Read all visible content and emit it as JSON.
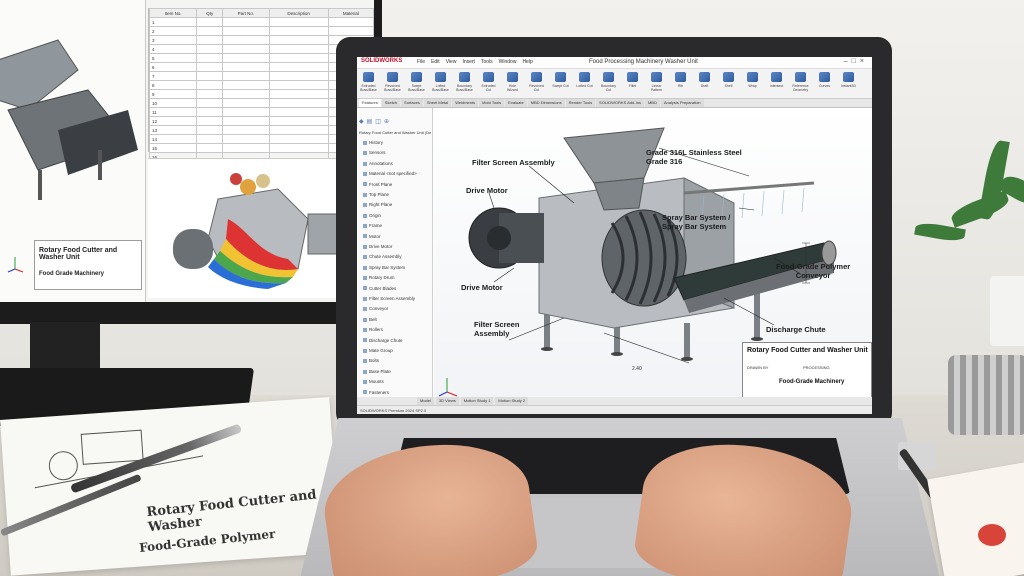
{
  "ext_monitor": {
    "table_headers": [
      "Item No.",
      "Qty",
      "Part No.",
      "Description",
      "Material"
    ],
    "part_numbers": [
      "1",
      "2",
      "3",
      "4",
      "5",
      "6",
      "7",
      "8",
      "9",
      "10",
      "11",
      "12",
      "13",
      "14",
      "15",
      "16"
    ],
    "title_block_name": "Rotary Food Cutter and Washer Unit",
    "title_block_company": "Food Grade Machinery"
  },
  "paper": {
    "line1": "Rotary Food Cutter and Washer",
    "line2": "Food-Grade Polymer"
  },
  "app": {
    "logo_text": "SOLIDWORKS",
    "document_title": "Food Processing Machinery Washer Unit",
    "menus": [
      "File",
      "Edit",
      "View",
      "Insert",
      "Tools",
      "Window",
      "Help"
    ],
    "toolbar": [
      {
        "icon": "extruded-boss-icon",
        "label": "Extruded Boss/Base"
      },
      {
        "icon": "revolved-boss-icon",
        "label": "Revolved Boss/Base"
      },
      {
        "icon": "swept-boss-icon",
        "label": "Swept Boss/Base"
      },
      {
        "icon": "lofted-boss-icon",
        "label": "Lofted Boss/Base"
      },
      {
        "icon": "boundary-boss-icon",
        "label": "Boundary Boss/Base"
      },
      {
        "icon": "extruded-cut-icon",
        "label": "Extruded Cut"
      },
      {
        "icon": "hole-wizard-icon",
        "label": "Hole Wizard"
      },
      {
        "icon": "revolved-cut-icon",
        "label": "Revolved Cut"
      },
      {
        "icon": "swept-cut-icon",
        "label": "Swept Cut"
      },
      {
        "icon": "lofted-cut-icon",
        "label": "Lofted Cut"
      },
      {
        "icon": "boundary-cut-icon",
        "label": "Boundary Cut"
      },
      {
        "icon": "fillet-icon",
        "label": "Fillet"
      },
      {
        "icon": "linear-pattern-icon",
        "label": "Linear Pattern"
      },
      {
        "icon": "rib-icon",
        "label": "Rib"
      },
      {
        "icon": "draft-icon",
        "label": "Draft"
      },
      {
        "icon": "shell-icon",
        "label": "Shell"
      },
      {
        "icon": "wrap-icon",
        "label": "Wrap"
      },
      {
        "icon": "intersect-icon",
        "label": "Intersect"
      },
      {
        "icon": "reference-geometry-icon",
        "label": "Reference Geometry"
      },
      {
        "icon": "curves-icon",
        "label": "Curves"
      },
      {
        "icon": "instant3d-icon",
        "label": "Instant3D"
      }
    ],
    "command_tabs": [
      "Features",
      "Sketch",
      "Surfaces",
      "Sheet Metal",
      "Weldments",
      "Mold Tools",
      "Evaluate",
      "MBD Dimensions",
      "Render Tools",
      "SOLIDWORKS Add-Ins",
      "MBD",
      "Analysis Preparation"
    ],
    "tree_header": "Rotary Food Cutter and Washer Unit (Default)",
    "tree_items": [
      "History",
      "Sensors",
      "Annotations",
      "Material <not specified>",
      "Front Plane",
      "Top Plane",
      "Right Plane",
      "Origin",
      "Frame",
      "Motor",
      "Drive Motor",
      "Chute Assembly",
      "Spray Bar System",
      "Rotary Drum",
      "Cutter Blades",
      "Filter Screen Assembly",
      "Conveyor",
      "Belt",
      "Rollers",
      "Discharge Chute",
      "Mate Group",
      "Bolts",
      "Base Plate",
      "Mounts",
      "Fasteners"
    ],
    "callouts": {
      "grade": "Grade 316L Stainless Steel\nGrade 316",
      "filter_top": "Filter Screen Assembly",
      "spray": "Spray Bar System /\nSpray Bar System",
      "drive_top": "Drive Motor",
      "conveyor": "Food-Grade Polymer\nConveyor",
      "drive_bottom": "Drive Motor",
      "filter_bottom": "Filter Screen\nAssembly",
      "discharge": "Discharge Chute"
    },
    "dimensions": {
      "width": "2.40",
      "height": "1.0.3"
    },
    "title_block": {
      "name": "Rotary Food Cutter and Washer Unit",
      "field1": "DRAWN BY",
      "field2": "PROCESSING",
      "company": "Food-Grade Machinery"
    },
    "bottom_tabs": [
      "Model",
      "3D Views",
      "Motion Study 1",
      "Motion Study 2"
    ],
    "status_text": "SOLIDWORKS Premium 2024 SP2.0"
  }
}
